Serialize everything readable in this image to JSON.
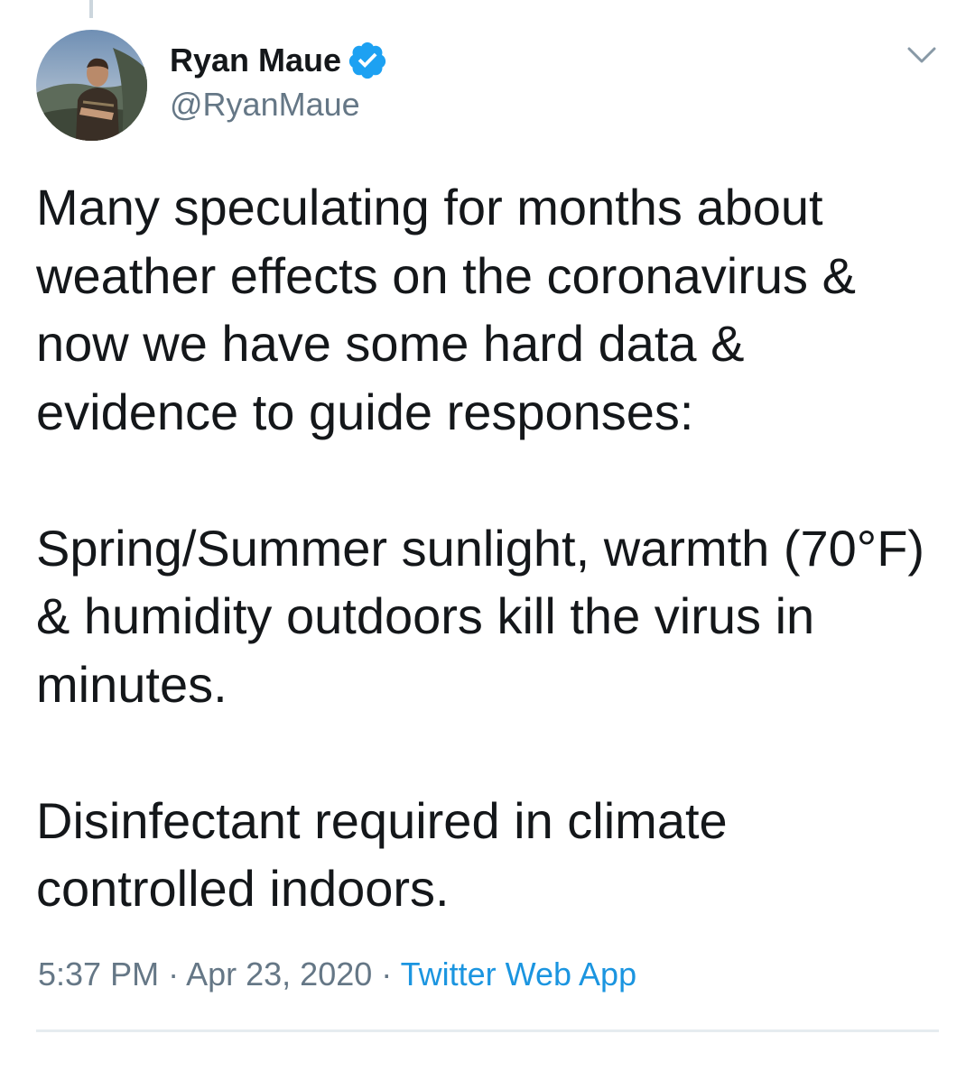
{
  "author": {
    "display_name": "Ryan Maue",
    "handle": "@RyanMaue",
    "verified": true,
    "avatar_icon": "profile-photo"
  },
  "tweet": {
    "paragraphs": [
      "Many speculating for months about weather effects on the coronavirus & now we have some hard data & evidence to guide responses:",
      "Spring/Summer sunlight, warmth (70°F) & humidity outdoors kill the virus in minutes.",
      "Disinfectant required in climate controlled indoors."
    ]
  },
  "meta": {
    "time": "5:37 PM",
    "separator": "·",
    "date": "Apr 23, 2020",
    "source": "Twitter Web App"
  },
  "colors": {
    "text": "#14171a",
    "secondary": "#657786",
    "link": "#1b95e0",
    "verified": "#1da1f2",
    "divider": "#e6ecf0"
  },
  "icons": {
    "verified": "verified-badge-icon",
    "menu": "chevron-down-icon"
  }
}
